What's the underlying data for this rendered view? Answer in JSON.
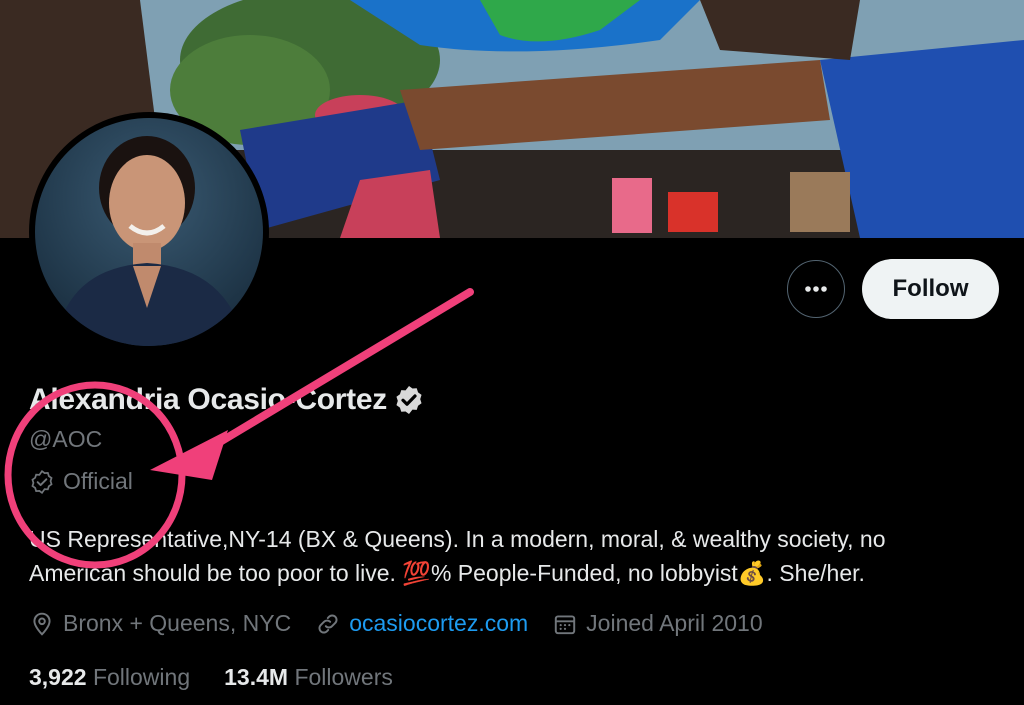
{
  "profile": {
    "display_name": "Alexandria Ocasio-Cortez",
    "handle": "@AOC",
    "official_label": "Official",
    "bio_line1": "US Representative,NY-14 (BX & Queens). In a modern, moral, & wealthy society, no",
    "bio_line2": "American should be too poor to live. 💯% People-Funded, no lobbyist💰. She/her.",
    "location": "Bronx + Queens, NYC",
    "website": "ocasiocortez.com",
    "joined": "Joined April 2010"
  },
  "stats": {
    "following_count": "3,922",
    "following_label": "Following",
    "followers_count": "13.4M",
    "followers_label": "Followers"
  },
  "actions": {
    "follow_label": "Follow",
    "more_icon": "more-horizontal-icon"
  },
  "icons": {
    "verified": "verified-badge-icon",
    "official": "official-badge-icon",
    "location": "location-pin-icon",
    "link": "link-icon",
    "calendar": "calendar-icon"
  },
  "colors": {
    "background": "#000000",
    "text_primary": "#e7e9ea",
    "text_secondary": "#71767b",
    "link": "#1d9bf0",
    "follow_bg": "#eff3f4",
    "annotation": "#f0407a"
  }
}
